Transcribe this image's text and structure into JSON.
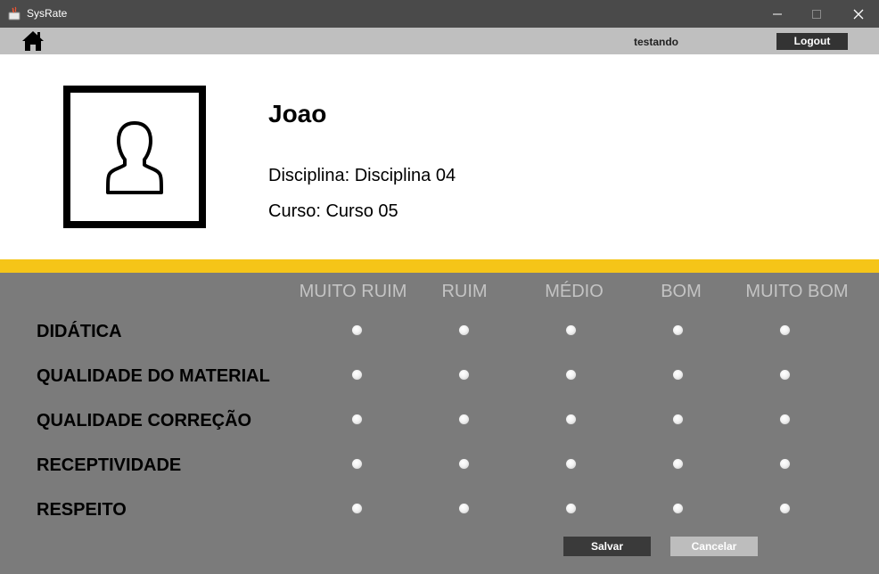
{
  "window": {
    "title": "SysRate"
  },
  "topbar": {
    "username": "testando",
    "logout_label": "Logout"
  },
  "profile": {
    "name": "Joao",
    "disciplina": "Disciplina: Disciplina 04",
    "curso": "Curso: Curso 05"
  },
  "rating": {
    "columns": [
      "MUITO RUIM",
      "RUIM",
      "MÉDIO",
      "BOM",
      "MUITO BOM"
    ],
    "criteria": [
      "DIDÁTICA",
      "QUALIDADE DO MATERIAL",
      "QUALIDADE CORREÇÃO",
      "RECEPTIVIDADE",
      "RESPEITO"
    ]
  },
  "actions": {
    "save_label": "Salvar",
    "cancel_label": "Cancelar"
  },
  "colors": {
    "accent_stripe": "#f5c518",
    "panel_bg": "#7b7b7b",
    "topbar_bg": "#bfbfbf"
  }
}
